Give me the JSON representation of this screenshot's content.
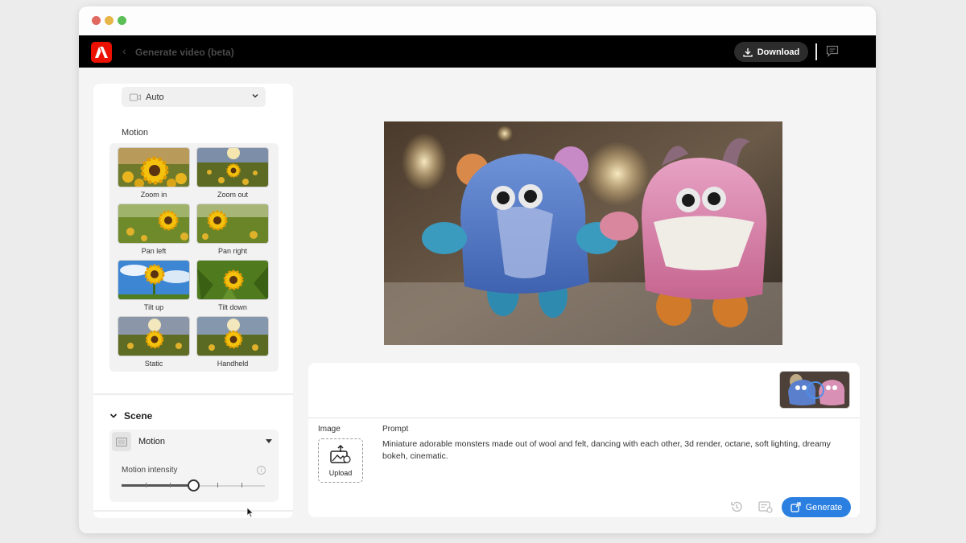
{
  "header": {
    "title": "Generate video (beta)",
    "download_label": "Download"
  },
  "sidebar": {
    "camera_select": "Auto",
    "motion_heading": "Motion",
    "motion_presets": [
      {
        "label": "Zoom in",
        "selected": true
      },
      {
        "label": "Zoom out"
      },
      {
        "label": "Pan left"
      },
      {
        "label": "Pan right"
      },
      {
        "label": "Tilt up"
      },
      {
        "label": "Tilt down"
      },
      {
        "label": "Static"
      },
      {
        "label": "Handheld"
      }
    ],
    "scene": {
      "title": "Scene",
      "select_value": "Motion",
      "intensity_label": "Motion intensity",
      "intensity_fraction": 0.5
    }
  },
  "prompt_panel": {
    "image_label": "Image",
    "upload_label": "Upload",
    "prompt_label": "Prompt",
    "prompt_text": "Miniature adorable monsters made out of wool and felt, dancing with each other, 3d render, octane, soft lighting, dreamy bokeh, cinematic.",
    "generate_label": "Generate"
  },
  "colors": {
    "brand_red": "#eb1000",
    "generate_blue": "#2a7fe0",
    "appbar_bg": "#000000"
  }
}
